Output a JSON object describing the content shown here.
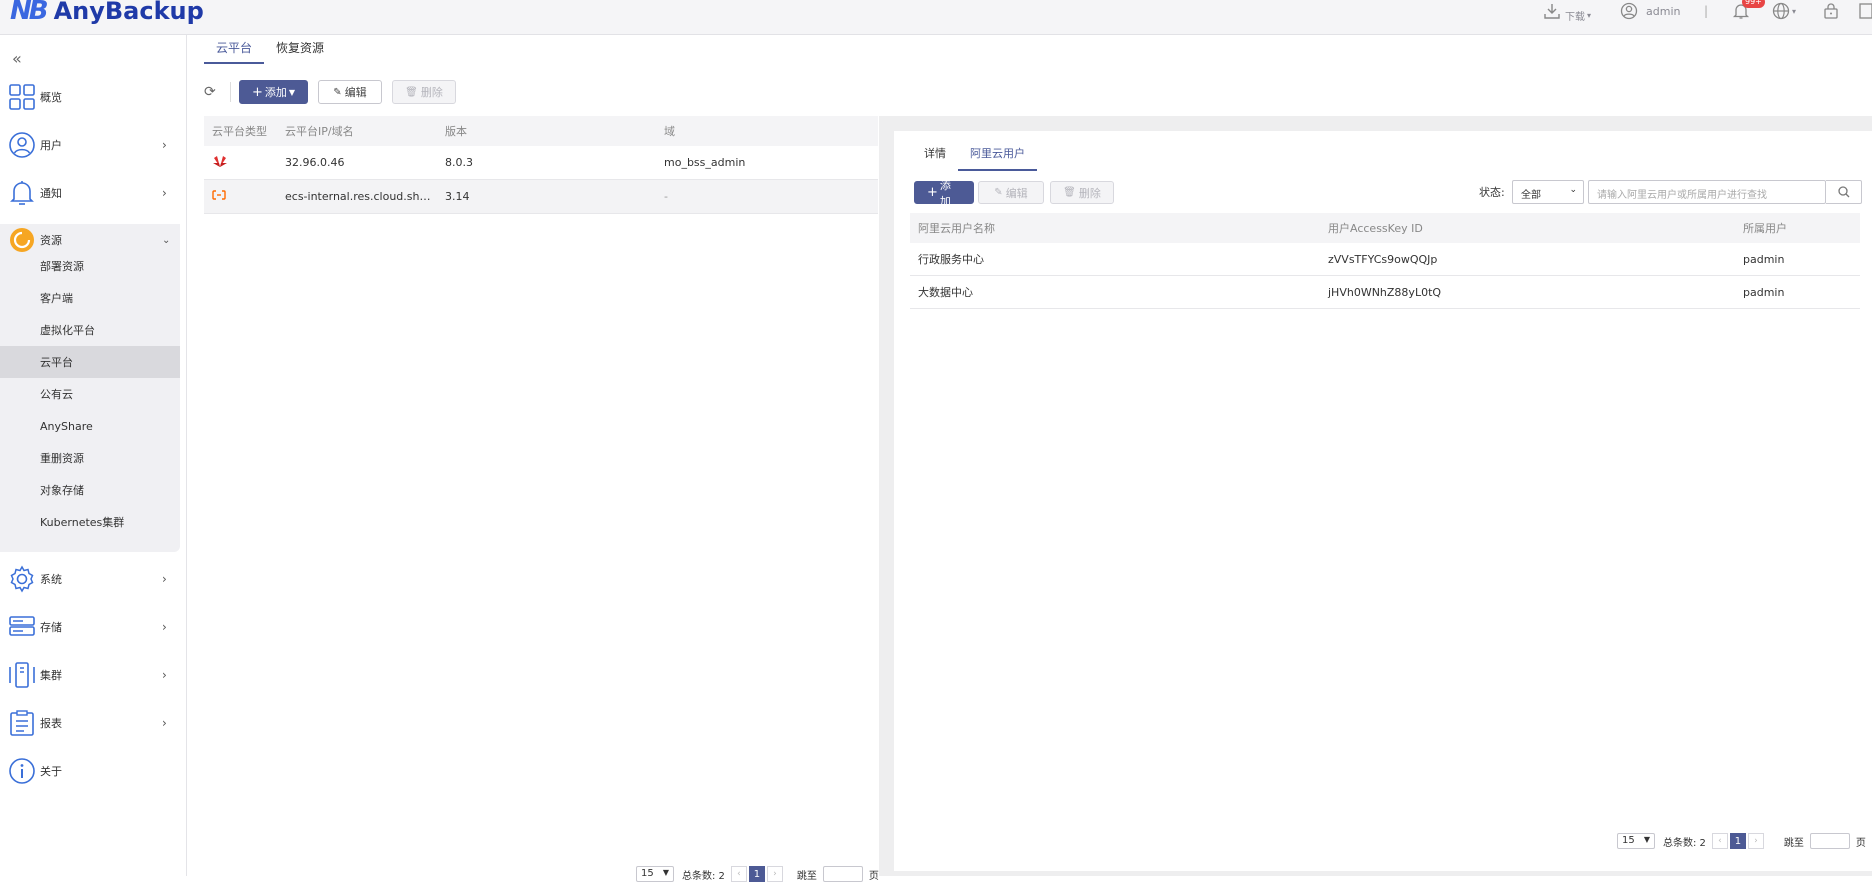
{
  "app": {
    "logo_text": "AnyBackup",
    "logo_mark": "NB"
  },
  "header": {
    "download_label": "下载",
    "user_label": "admin",
    "separator": "|",
    "notification_badge": "99+"
  },
  "sidebar": {
    "collapse_icon": "«",
    "items": [
      {
        "label": "概览",
        "icon": "grid-icon"
      },
      {
        "label": "用户",
        "icon": "user-icon"
      },
      {
        "label": "通知",
        "icon": "bell-icon"
      },
      {
        "label": "资源",
        "icon": "resource-icon"
      },
      {
        "label": "系统",
        "icon": "gear-icon"
      },
      {
        "label": "存储",
        "icon": "storage-icon"
      },
      {
        "label": "集群",
        "icon": "cluster-icon"
      },
      {
        "label": "报表",
        "icon": "report-icon"
      },
      {
        "label": "关于",
        "icon": "info-icon"
      }
    ],
    "sub_items": [
      {
        "label": "部署资源"
      },
      {
        "label": "客户端"
      },
      {
        "label": "虚拟化平台"
      },
      {
        "label": "云平台"
      },
      {
        "label": "公有云"
      },
      {
        "label": "AnyShare"
      },
      {
        "label": "重删资源"
      },
      {
        "label": "对象存储"
      },
      {
        "label": "Kubernetes集群"
      }
    ]
  },
  "main": {
    "tabs": [
      {
        "label": "云平台"
      },
      {
        "label": "恢复资源"
      }
    ],
    "toolbar": {
      "add_label": "添加",
      "edit_label": "编辑",
      "delete_label": "删除"
    },
    "table": {
      "columns": [
        "云平台类型",
        "云平台IP/域名",
        "版本",
        "域"
      ],
      "rows": [
        {
          "type_icon": "huawei-logo-icon",
          "host": "32.96.0.46",
          "version": "8.0.3",
          "domain": "mo_bss_admin"
        },
        {
          "type_icon": "aliyun-logo-icon",
          "host": "ecs-internal.res.cloud.shmh···",
          "version": "3.14",
          "domain": "-"
        }
      ]
    },
    "pager": {
      "page_size": "15",
      "total_label": "总条数: 2",
      "current": "1",
      "goto_label": "跳至",
      "page_suffix": "页"
    }
  },
  "detail": {
    "tabs": [
      {
        "label": "详情"
      },
      {
        "label": "阿里云用户"
      }
    ],
    "toolbar": {
      "add_label": "添加",
      "edit_label": "编辑",
      "delete_label": "删除"
    },
    "filter": {
      "status_label": "状态:",
      "status_value": "全部",
      "search_placeholder": "请输入阿里云用户或所属用户进行查找"
    },
    "table": {
      "columns": [
        "阿里云用户名称",
        "用户AccessKey ID",
        "所属用户"
      ],
      "rows": [
        {
          "name": "行政服务中心",
          "key": "zVVsTFYCs9owQQJp",
          "owner": "padmin"
        },
        {
          "name": "大数据中心",
          "key": "jHVh0WNhZ88yL0tQ",
          "owner": "padmin"
        }
      ]
    },
    "pager": {
      "page_size": "15",
      "total_label": "总条数: 2",
      "current": "1",
      "goto_label": "跳至",
      "page_suffix": "页"
    }
  }
}
